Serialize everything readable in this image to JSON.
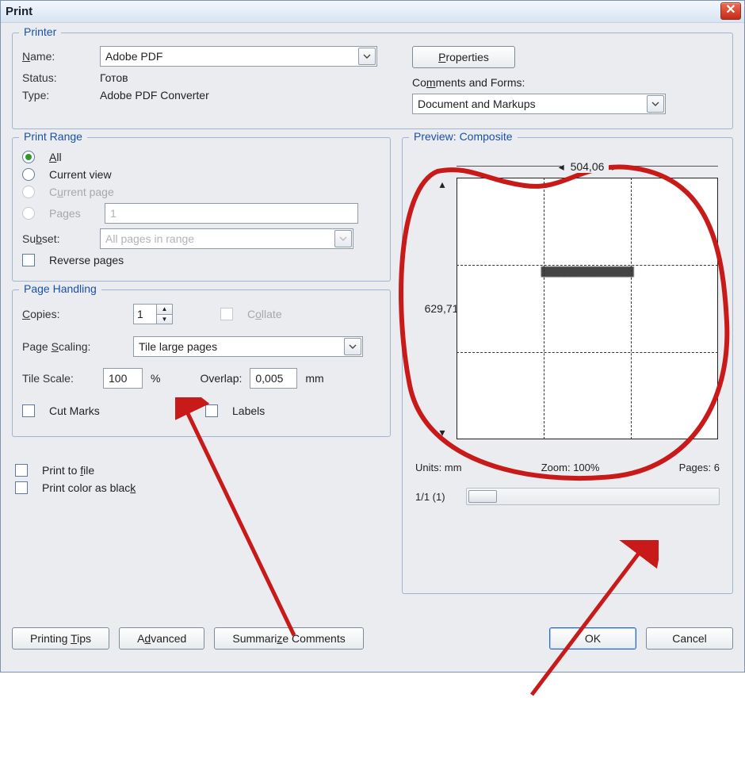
{
  "window": {
    "title": "Print"
  },
  "printer": {
    "legend": "Printer",
    "name_label": "Name:",
    "name_value": "Adobe PDF",
    "properties_btn": "Properties",
    "status_label": "Status:",
    "status_value": "Готов",
    "type_label": "Type:",
    "type_value": "Adobe PDF Converter",
    "comments_label": "Comments and Forms:",
    "comments_value": "Document and Markups"
  },
  "range": {
    "legend": "Print Range",
    "all": "All",
    "current_view": "Current view",
    "current_page": "Current page",
    "pages": "Pages",
    "pages_value": "1",
    "subset_label": "Subset:",
    "subset_value": "All pages in range",
    "reverse": "Reverse pages"
  },
  "handling": {
    "legend": "Page Handling",
    "copies_label": "Copies:",
    "copies_value": "1",
    "collate": "Collate",
    "scaling_label": "Page Scaling:",
    "scaling_value": "Tile large pages",
    "tilescale_label": "Tile Scale:",
    "tilescale_value": "100",
    "tilescale_unit": "%",
    "overlap_label": "Overlap:",
    "overlap_value": "0,005",
    "overlap_unit": "mm",
    "cutmarks": "Cut Marks",
    "labels": "Labels"
  },
  "misc": {
    "print_to_file": "Print to file",
    "print_black": "Print color as black"
  },
  "footer": {
    "tips": "Printing Tips",
    "advanced": "Advanced",
    "summarize": "Summarize Comments",
    "ok": "OK",
    "cancel": "Cancel"
  },
  "preview": {
    "legend": "Preview: Composite",
    "width": "504,06",
    "height": "629,71",
    "units_label": "Units:",
    "units_value": "mm",
    "zoom_label": "Zoom:",
    "zoom_value": "100%",
    "pages_label": "Pages:",
    "pages_value": "6",
    "nav": "1/1 (1)"
  }
}
